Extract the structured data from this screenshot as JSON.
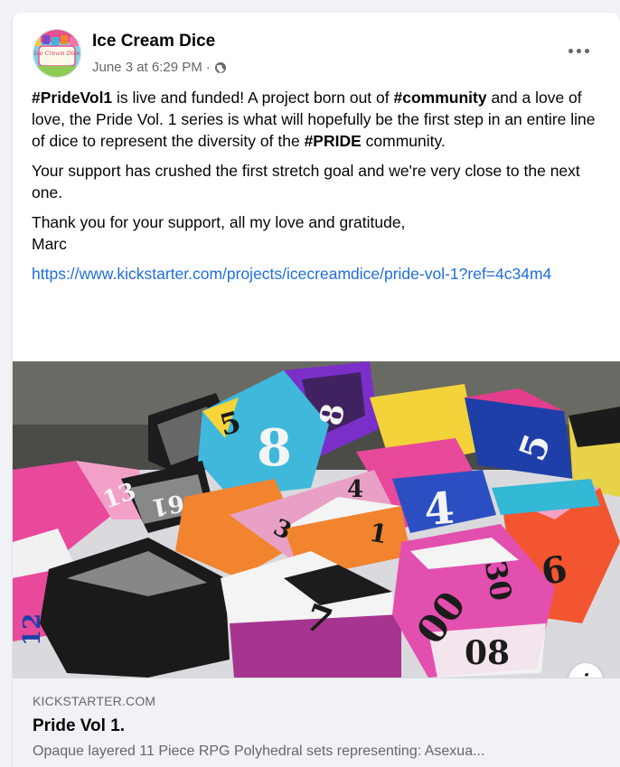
{
  "post": {
    "author": "Ice Cream Dice",
    "avatar_text": "Ice Cream Dice",
    "timestamp": "June 3 at 6:29 PM",
    "separator": "·",
    "audience_icon": "globe-icon",
    "more_icon": "more-options-icon"
  },
  "text": {
    "p1_tag1": "#PrideVol1",
    "p1_a": " is live and funded! A project born out of ",
    "p1_tag2": "#community",
    "p1_b": " and a love of love, the Pride Vol. 1 series is what will hopefully be the first step in an entire line of dice to represent the diversity of the ",
    "p1_tag3": "#PRIDE",
    "p1_c": " community.",
    "p2": "Your support has crushed the first stretch goal and we're very close to the next one.",
    "p3_line1": "Thank you for your support, all my love and gratitude,",
    "p3_line2": "Marc",
    "link": "https://www.kickstarter.com/projects/icecreamdice/pride-vol-1?ref=4c34m4"
  },
  "image": {
    "info_label": "i",
    "die_numbers": [
      "8",
      "5",
      "8",
      "4",
      "5",
      "6",
      "7",
      "00",
      "30",
      "08",
      "13",
      "61",
      "3",
      "4",
      "1",
      "12"
    ]
  },
  "preview": {
    "domain": "KICKSTARTER.COM",
    "title": "Pride Vol 1.",
    "description": "Opaque layered 11 Piece RPG Polyhedral sets representing: Asexua..."
  },
  "colors": {
    "link": "#216fdb",
    "secondary_text": "#65676b",
    "background": "#f0f2f5"
  }
}
